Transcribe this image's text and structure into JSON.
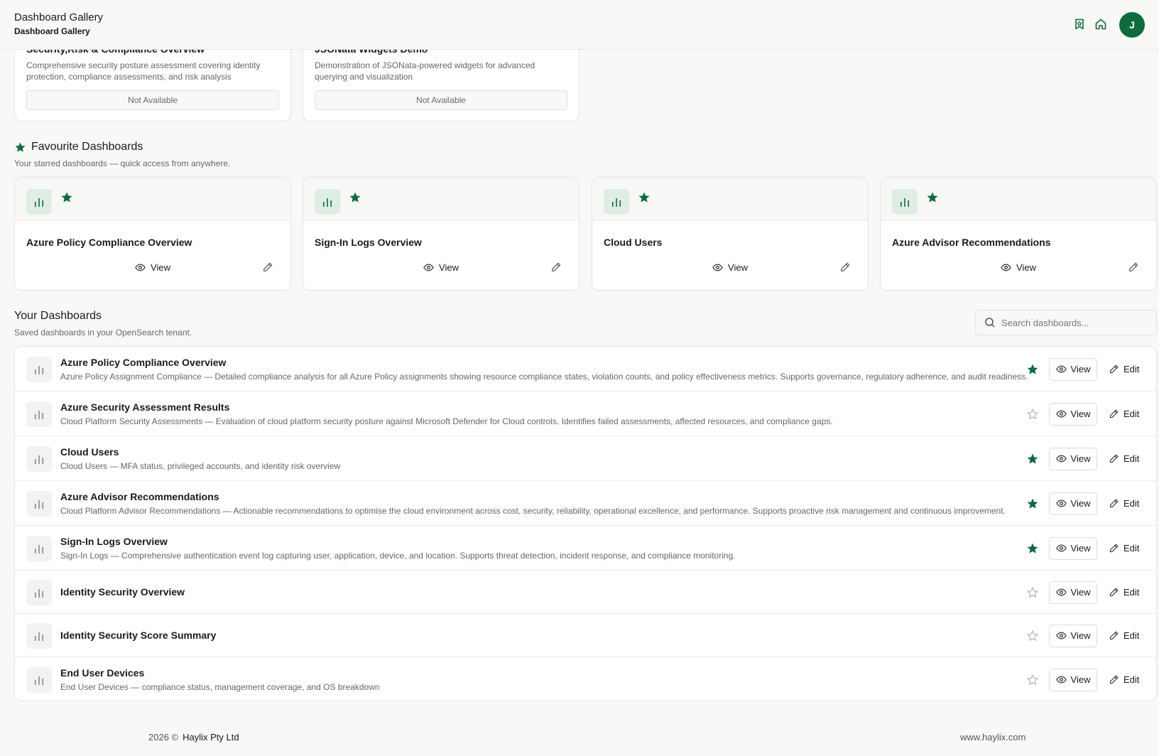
{
  "header": {
    "title": "Dashboard Gallery",
    "subtitle": "Dashboard Gallery",
    "avatar_initial": "J"
  },
  "colors": {
    "accent": "#0f6b3c",
    "muted_icon": "#8a8a8a"
  },
  "top_cards": [
    {
      "title": "Security,Risk & Compliance Overview",
      "description": "Comprehensive security posture assessment covering identity protection, compliance assessments, and risk analysis",
      "button": "Not Available"
    },
    {
      "title": "JSONata Widgets Demo",
      "description": "Demonstration of JSONata-powered widgets for advanced querying and visualization",
      "button": "Not Available"
    }
  ],
  "favourites": {
    "title": "Favourite Dashboards",
    "subtitle": "Your starred dashboards — quick access from anywhere.",
    "view_label": "View",
    "items": [
      {
        "title": "Azure Policy Compliance Overview"
      },
      {
        "title": "Sign-In Logs Overview"
      },
      {
        "title": "Cloud Users"
      },
      {
        "title": "Azure Advisor Recommendations"
      }
    ]
  },
  "your_dashboards": {
    "title": "Your Dashboards",
    "subtitle": "Saved dashboards in your OpenSearch tenant.",
    "search_placeholder": "Search dashboards...",
    "view_label": "View",
    "edit_label": "Edit",
    "items": [
      {
        "title": "Azure Policy Compliance Overview",
        "description": "Azure Policy Assignment Compliance — Detailed compliance analysis for all Azure Policy assignments showing resource compliance states, violation counts, and policy effectiveness metrics. Supports governance, regulatory adherence, and audit readiness.",
        "starred": true
      },
      {
        "title": "Azure Security Assessment Results",
        "description": "Cloud Platform Security Assessments — Evaluation of cloud platform security posture against Microsoft Defender for Cloud controls. Identifies failed assessments, affected resources, and compliance gaps.",
        "starred": false
      },
      {
        "title": "Cloud Users",
        "description": "Cloud Users — MFA status, privileged accounts, and identity risk overview",
        "starred": true
      },
      {
        "title": "Azure Advisor Recommendations",
        "description": "Cloud Platform Advisor Recommendations — Actionable recommendations to optimise the cloud environment across cost, security, reliability, operational excellence, and performance. Supports proactive risk management and continuous improvement.",
        "starred": true
      },
      {
        "title": "Sign-In Logs Overview",
        "description": "Sign-In Logs — Comprehensive authentication event log capturing user, application, device, and location. Supports threat detection, incident response, and compliance monitoring.",
        "starred": true
      },
      {
        "title": "Identity Security Overview",
        "description": "",
        "starred": false
      },
      {
        "title": "Identity Security Score Summary",
        "description": "",
        "starred": false
      },
      {
        "title": "End User Devices",
        "description": "End User Devices — compliance status, management coverage, and OS breakdown",
        "starred": false
      }
    ]
  },
  "footer": {
    "year": "2026 ©",
    "company": "Haylix Pty Ltd",
    "website": "www.haylix.com"
  }
}
